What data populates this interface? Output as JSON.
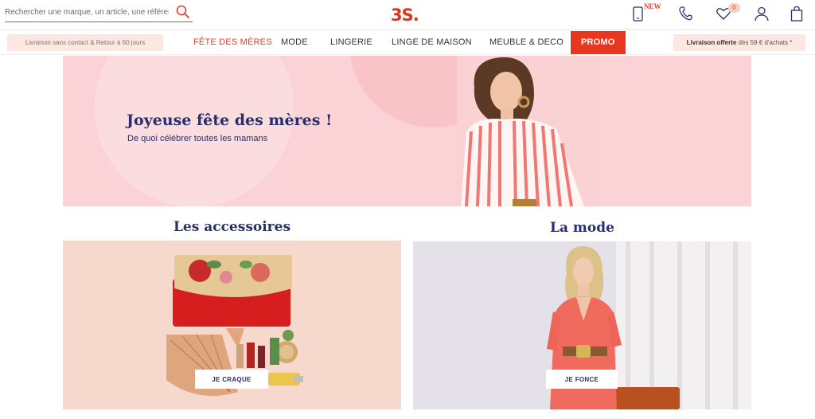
{
  "header": {
    "search_placeholder": "Rechercher une marque, un article, une référence",
    "logo": "3S.",
    "new_badge": "NEW",
    "wishlist_count": "0",
    "icons": [
      "search-icon",
      "mobile-app-icon",
      "phone-icon",
      "heart-icon",
      "user-icon",
      "bag-icon"
    ]
  },
  "nav": {
    "left_banner": "Livraison sans contact & Retour à 60 jours",
    "items": [
      "FÊTE DES MÈRES",
      "MODE",
      "LINGERIE",
      "LINGE DE MAISON",
      "MEUBLE & DECO",
      "PROMO"
    ],
    "right_banner_bold": "Livraison offerte",
    "right_banner_rest": " dès 59 € d'achats *"
  },
  "hero": {
    "title": "Joyeuse fête des mères !",
    "subtitle": "De quoi célébrer toutes les mamans"
  },
  "sections": [
    {
      "title": "Les accessoires",
      "button": "JE CRAQUE"
    },
    {
      "title": "La mode",
      "button": "JE FONCE"
    }
  ],
  "colors": {
    "accent": "#e0412b",
    "navy": "#27306b",
    "hero_bg": "#fbd2d5",
    "banner_bg": "#fce8e1"
  }
}
